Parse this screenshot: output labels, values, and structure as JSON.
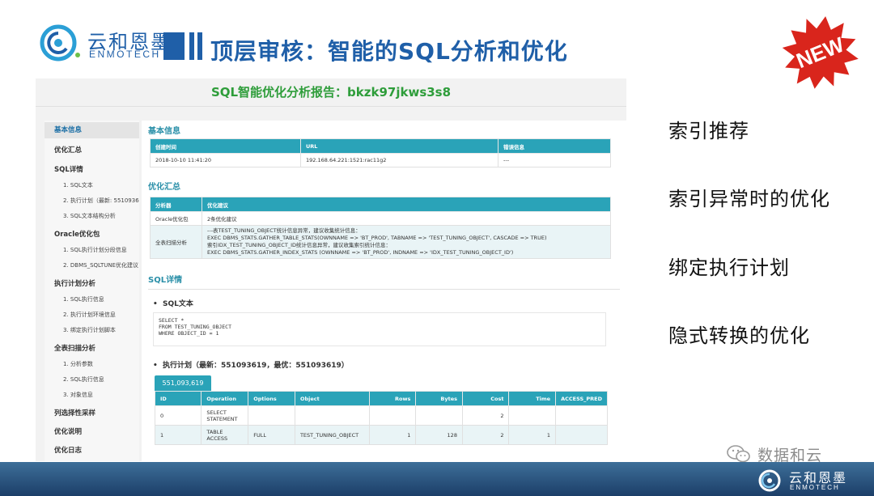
{
  "header": {
    "logo_cn": "云和恩墨",
    "logo_en": "ENMOTECH",
    "title": "顶层审核：智能的SQL分析和优化",
    "badge": "NEW"
  },
  "report": {
    "title": "SQL智能优化分析报告：bkzk97jkws3s8",
    "nav": [
      {
        "label": "基本信息",
        "level": "section",
        "active": true
      },
      {
        "label": "优化汇总",
        "level": "section"
      },
      {
        "label": "SQL详情",
        "level": "section"
      },
      {
        "label": "1. SQL文本",
        "level": "sub"
      },
      {
        "label": "2. 执行计划（最新: 5510936",
        "level": "sub"
      },
      {
        "label": "3. SQL文本结构分析",
        "level": "sub"
      },
      {
        "label": "Oracle优化包",
        "level": "section"
      },
      {
        "label": "1. SQL执行计划分段信息",
        "level": "sub"
      },
      {
        "label": "2. DBMS_SQLTUNE优化建议",
        "level": "sub"
      },
      {
        "label": "执行计划分析",
        "level": "section"
      },
      {
        "label": "1. SQL执行信息",
        "level": "sub"
      },
      {
        "label": "2. 执行计划环境信息",
        "level": "sub"
      },
      {
        "label": "3. 绑定执行计划脚本",
        "level": "sub"
      },
      {
        "label": "全表扫描分析",
        "level": "section"
      },
      {
        "label": "1. 分析参数",
        "level": "sub"
      },
      {
        "label": "2. SQL执行信息",
        "level": "sub"
      },
      {
        "label": "3. 对象信息",
        "level": "sub"
      },
      {
        "label": "列选择性采样",
        "level": "section"
      },
      {
        "label": "优化说明",
        "level": "section"
      },
      {
        "label": "优化日志",
        "level": "section"
      }
    ],
    "basic": {
      "heading": "基本信息",
      "columns": [
        "创建时间",
        "URL",
        "错误信息"
      ],
      "row": [
        "2018-10-10 11:41:20",
        "192.168.64.221:1521:rac11g2",
        "---"
      ]
    },
    "summary": {
      "heading": "优化汇总",
      "columns": [
        "分析器",
        "优化建议"
      ],
      "rows": [
        {
          "analyzer": "Oracle优化包",
          "advice": [
            "2条优化建议"
          ]
        },
        {
          "analyzer": "全表扫描分析",
          "advice": [
            "---表TEST_TUNING_OBJECT统计信息异常，建议收集统计信息：",
            "EXEC DBMS_STATS.GATHER_TABLE_STATS(OWNNAME => 'BT_PROD', TABNAME => 'TEST_TUNING_OBJECT', CASCADE => TRUE)",
            "索引IDX_TEST_TUNING_OBJECT_ID统计信息异常，建议收集索引统计信息：",
            "EXEC DBMS_STATS.GATHER_INDEX_STATS (OWNNAME => 'BT_PROD', INDNAME => 'IDX_TEST_TUNING_OBJECT_ID')"
          ]
        }
      ]
    },
    "sql_detail": {
      "heading": "SQL详情",
      "text_title": "SQL文本",
      "sql_lines": [
        "SELECT *",
        "FROM TEST_TUNING_OBJECT",
        "WHERE OBJECT_ID = 1"
      ],
      "plan_title": "执行计划（最新：551093619，最优：551093619）",
      "plan_tab": "551,093,619",
      "plan_columns": [
        "ID",
        "Operation",
        "Options",
        "Object",
        "Rows",
        "Bytes",
        "Cost",
        "Time",
        "ACCESS_PRED"
      ],
      "plan_rows": [
        [
          "0",
          "SELECT\nSTATEMENT",
          "",
          "",
          "",
          "",
          "2",
          "",
          ""
        ],
        [
          "1",
          "TABLE\nACCESS",
          "FULL",
          "TEST_TUNING_OBJECT",
          "1",
          "128",
          "2",
          "1",
          ""
        ]
      ]
    }
  },
  "features": [
    "索引推荐",
    "索引异常时的优化",
    "绑定执行计划",
    "隐式转换的优化"
  ],
  "watermark": "数据和云",
  "footer": {
    "logo_cn": "云和恩墨",
    "logo_en": "ENMOTECH"
  },
  "colors": {
    "brand_blue": "#1f5fa8",
    "report_green": "#2e9d3a",
    "table_teal": "#2aa3b8",
    "badge_red": "#d9251c"
  }
}
